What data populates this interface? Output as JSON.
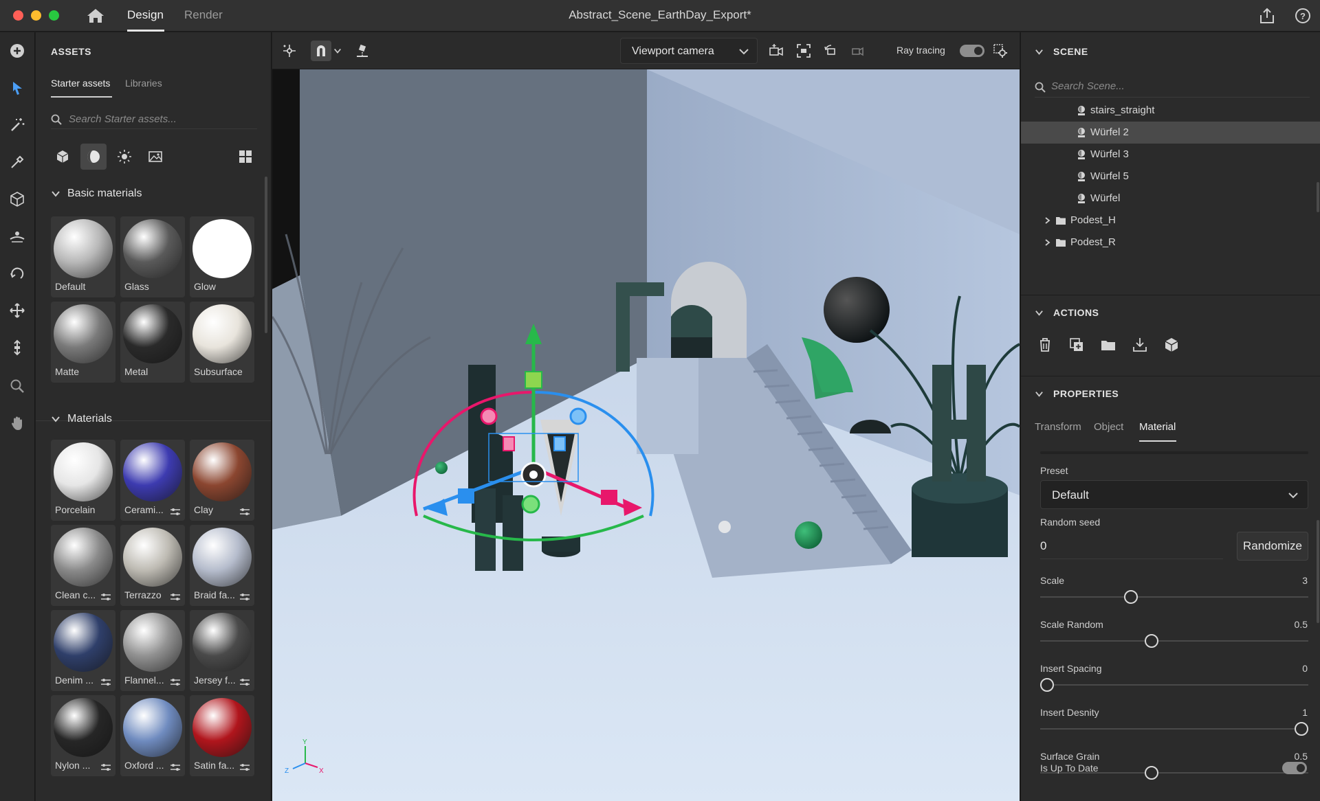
{
  "titlebar": {
    "tabs": [
      "Design",
      "Render"
    ],
    "active_tab": "Design",
    "document_title": "Abstract_Scene_EarthDay_Export*"
  },
  "assets": {
    "header": "ASSETS",
    "tabs": [
      "Starter assets",
      "Libraries"
    ],
    "search_placeholder": "Search Starter assets...",
    "category_icons": [
      "cube-icon",
      "material-ball-icon",
      "light-sun-icon",
      "image-icon"
    ],
    "basic_section": "Basic materials",
    "basic_materials": [
      {
        "label": "Default",
        "color": "#b8b8b8"
      },
      {
        "label": "Glass",
        "color": "#5a5a5a"
      },
      {
        "label": "Glow",
        "color": "#ffffff"
      },
      {
        "label": "Matte",
        "color": "#7a7a7a"
      },
      {
        "label": "Metal",
        "color": "#2a2a2a"
      },
      {
        "label": "Subsurface",
        "color": "#e8e4dc"
      }
    ],
    "materials_section": "Materials",
    "materials": [
      {
        "label": "Porcelain",
        "color": "#e6e6e6",
        "tunable": false
      },
      {
        "label": "Cerami...",
        "color": "#3d3bb0",
        "tunable": true
      },
      {
        "label": "Clay",
        "color": "#8b4630",
        "tunable": true
      },
      {
        "label": "Clean c...",
        "color": "#8a8a8a",
        "tunable": true
      },
      {
        "label": "Terrazzo",
        "color": "#bdbab2",
        "tunable": true
      },
      {
        "label": "Braid fa...",
        "color": "#b5bccc",
        "tunable": true
      },
      {
        "label": "Denim ...",
        "color": "#2f3f6a",
        "tunable": true
      },
      {
        "label": "Flannel...",
        "color": "#929292",
        "tunable": true
      },
      {
        "label": "Jersey f...",
        "color": "#4a4a4a",
        "tunable": true
      },
      {
        "label": "Nylon ...",
        "color": "#262626",
        "tunable": true
      },
      {
        "label": "Oxford ...",
        "color": "#6f8bbf",
        "tunable": true
      },
      {
        "label": "Satin fa...",
        "color": "#b0151c",
        "tunable": true
      }
    ]
  },
  "viewport": {
    "camera": "Viewport camera",
    "ray_tracing_label": "Ray tracing",
    "ray_tracing_on": true,
    "axis_labels": {
      "y": "Y",
      "x": "X",
      "z": "Z"
    }
  },
  "scene": {
    "header": "SCENE",
    "search_placeholder": "Search Scene...",
    "items": [
      {
        "label": "stairs_straight",
        "type": "object",
        "selected": false
      },
      {
        "label": "Würfel 2",
        "type": "object",
        "selected": true
      },
      {
        "label": "Würfel 3",
        "type": "object",
        "selected": false
      },
      {
        "label": "Würfel 5",
        "type": "object",
        "selected": false
      },
      {
        "label": "Würfel",
        "type": "object",
        "selected": false
      },
      {
        "label": "Podest_H",
        "type": "group",
        "selected": false
      },
      {
        "label": "Podest_R",
        "type": "group",
        "selected": false
      }
    ]
  },
  "actions": {
    "header": "ACTIONS",
    "icons": [
      "delete-icon",
      "duplicate-icon",
      "group-folder-icon",
      "export-icon",
      "package-icon"
    ]
  },
  "properties": {
    "header": "PROPERTIES",
    "tabs": [
      "Transform",
      "Object",
      "Material"
    ],
    "active_tab": "Material",
    "preset_label": "Preset",
    "preset_value": "Default",
    "random_seed_label": "Random seed",
    "random_seed_value": "0",
    "randomize_label": "Randomize",
    "sliders": [
      {
        "label": "Scale",
        "value": "3",
        "fraction": 0.33
      },
      {
        "label": "Scale Random",
        "value": "0.5",
        "fraction": 0.41
      },
      {
        "label": "Insert Spacing",
        "value": "0",
        "fraction": 0.0
      },
      {
        "label": "Insert Desnity",
        "value": "1",
        "fraction": 1.0
      },
      {
        "label": "Surface Grain",
        "value": "0.5",
        "fraction": 0.41
      }
    ],
    "up_to_date_label": "Is Up To Date",
    "up_to_date_on": true
  }
}
